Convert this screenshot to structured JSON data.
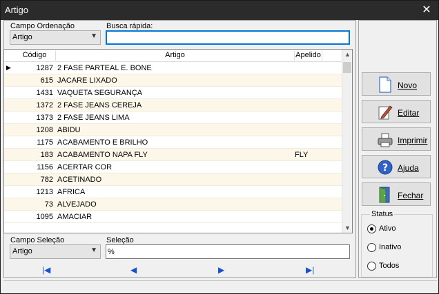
{
  "window": {
    "title": "Artigo",
    "close_glyph": "✕"
  },
  "top": {
    "sort_label": "Campo Ordenação",
    "sort_value": "Artigo",
    "search_label": "Busca rápida:",
    "search_value": ""
  },
  "grid": {
    "columns": [
      "Código",
      "Artigo",
      "Apelido"
    ],
    "rows": [
      {
        "codigo": "1287",
        "artigo": "2 FASE PARTEAL E. BONE",
        "apelido": "",
        "current": true
      },
      {
        "codigo": "615",
        "artigo": "JACARE LIXADO",
        "apelido": ""
      },
      {
        "codigo": "1431",
        "artigo": "VAQUETA SEGURANÇA",
        "apelido": ""
      },
      {
        "codigo": "1372",
        "artigo": "2 FASE JEANS CEREJA",
        "apelido": ""
      },
      {
        "codigo": "1373",
        "artigo": "2 FASE JEANS LIMA",
        "apelido": ""
      },
      {
        "codigo": "1208",
        "artigo": "ABIDU",
        "apelido": ""
      },
      {
        "codigo": "1175",
        "artigo": "ACABAMENTO E BRILHO",
        "apelido": ""
      },
      {
        "codigo": "183",
        "artigo": "ACABAMENTO NAPA FLY",
        "apelido": "FLY"
      },
      {
        "codigo": "1156",
        "artigo": "ACERTAR COR",
        "apelido": ""
      },
      {
        "codigo": "782",
        "artigo": "ACETINADO",
        "apelido": ""
      },
      {
        "codigo": "1213",
        "artigo": "AFRICA",
        "apelido": ""
      },
      {
        "codigo": "73",
        "artigo": "ALVEJADO",
        "apelido": ""
      },
      {
        "codigo": "1095",
        "artigo": "AMACIAR",
        "apelido": ""
      }
    ]
  },
  "bottom": {
    "field_label": "Campo Seleção",
    "field_value": "Artigo",
    "selection_label": "Seleção",
    "selection_value": "%"
  },
  "nav": {
    "first": "|◀",
    "prev": "◀",
    "next": "▶",
    "last": "▶|"
  },
  "actions": {
    "novo": "Novo",
    "editar": "Editar",
    "imprimir": "Imprimir",
    "ajuda": "Ajuda",
    "fechar": "Fechar"
  },
  "status": {
    "legend": "Status",
    "options": [
      "Ativo",
      "Inativo",
      "Todos"
    ],
    "selected": "Ativo"
  }
}
